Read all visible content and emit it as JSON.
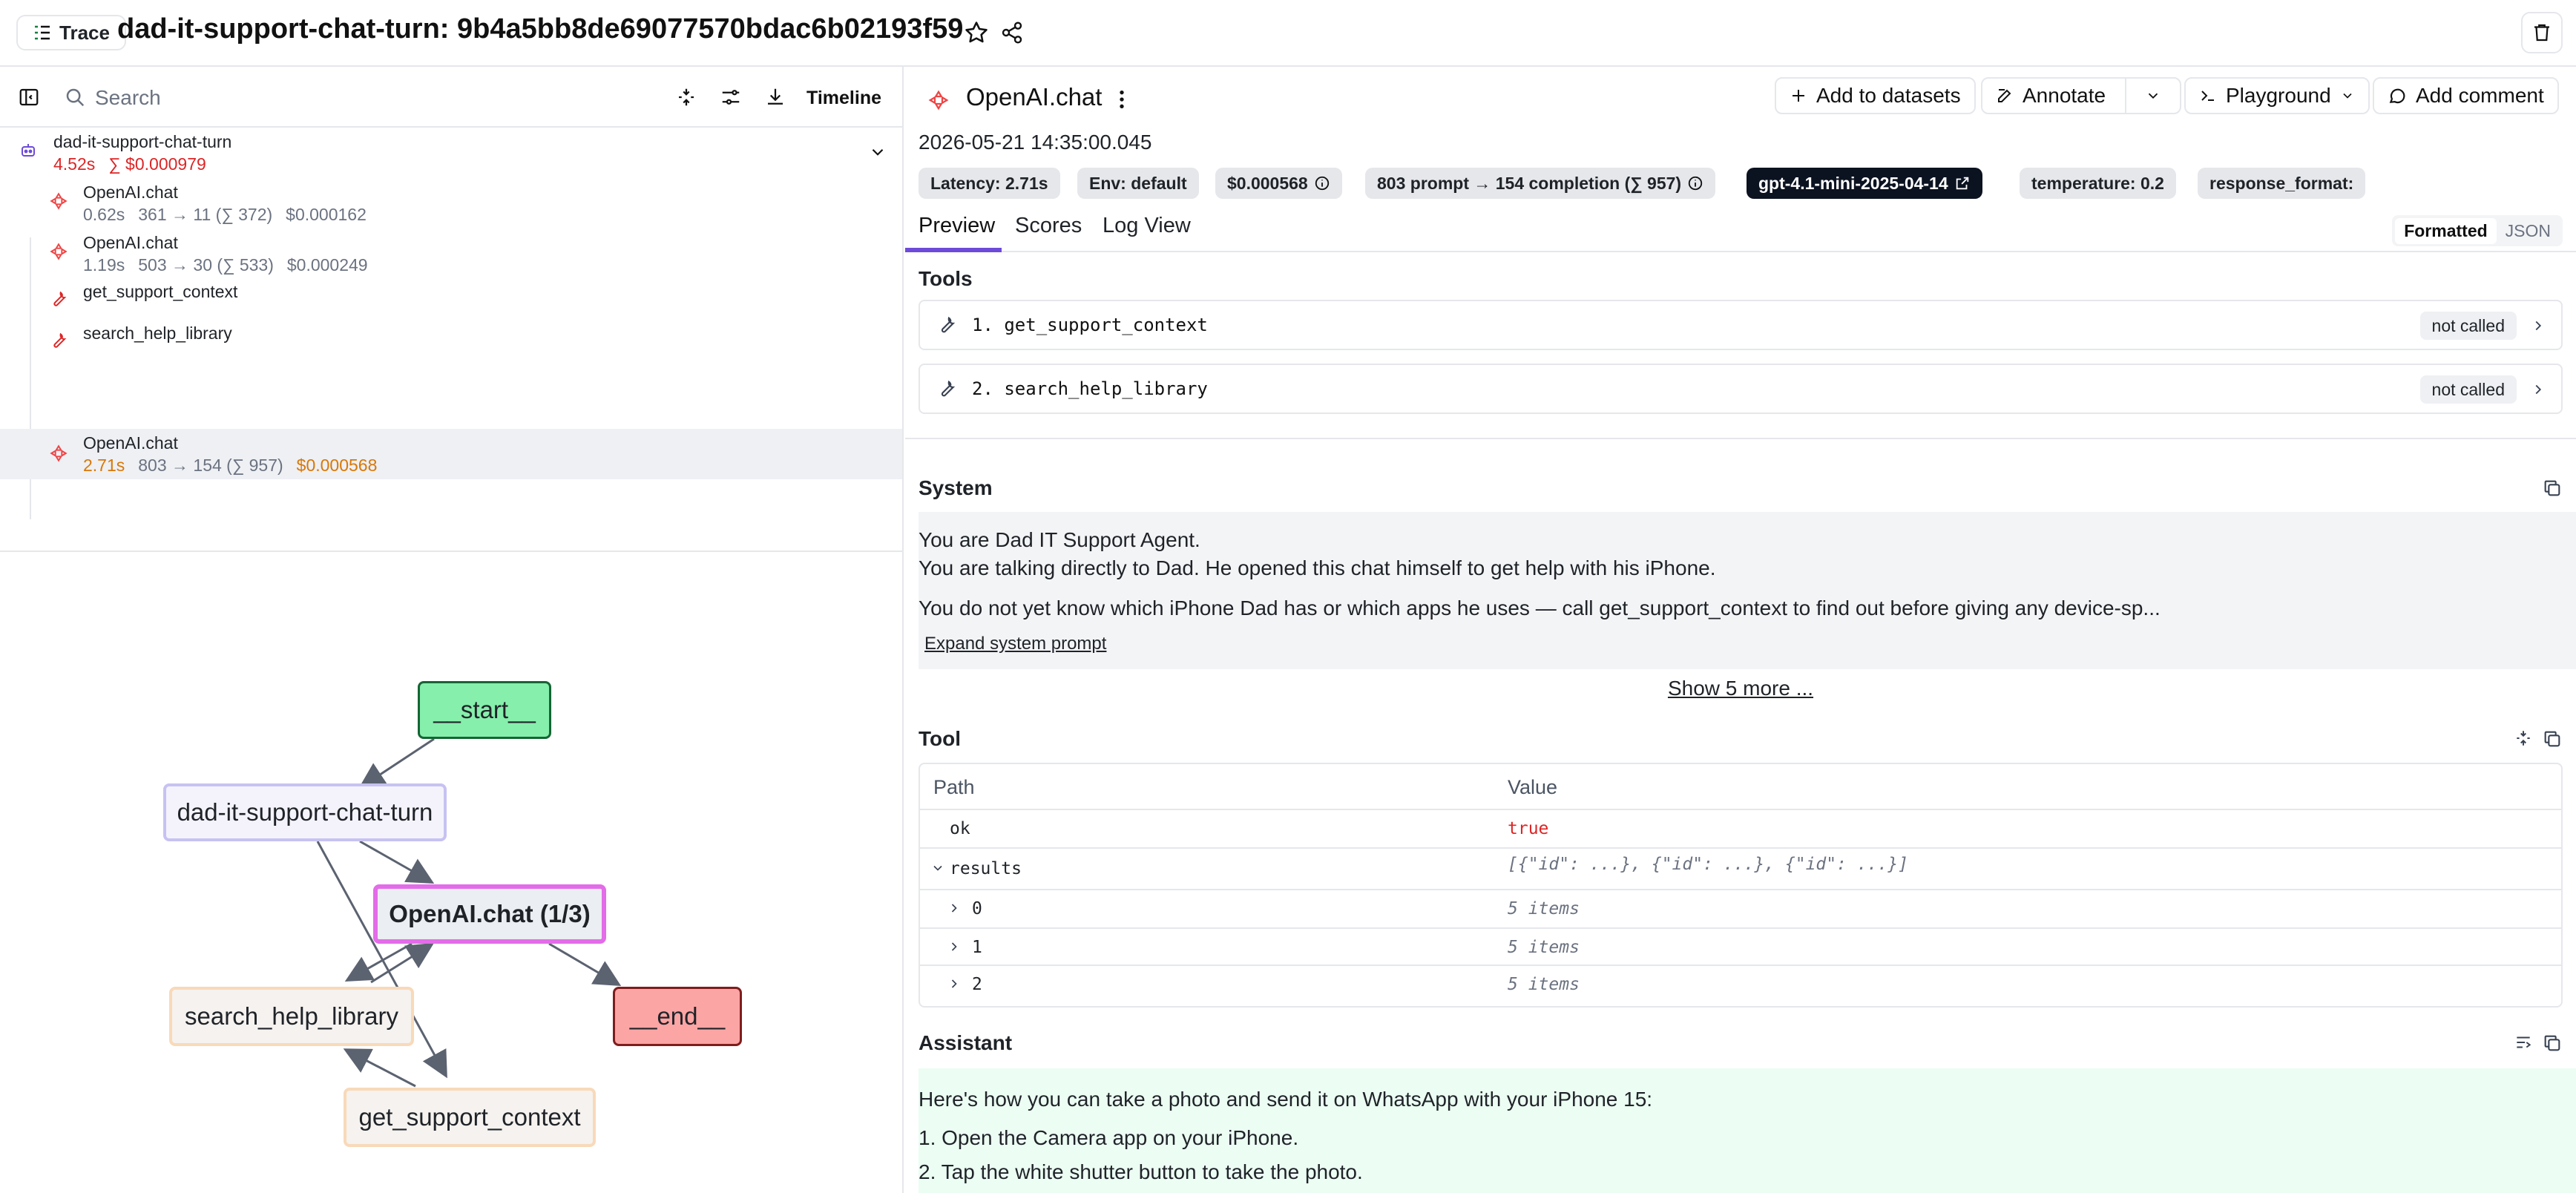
{
  "topbar": {
    "trace_label": "Trace",
    "title": "dad-it-support-chat-turn: 9b4a5bb8de69077570bdac6b02193f59"
  },
  "left": {
    "search_placeholder": "Search",
    "timeline_label": "Timeline",
    "tree": [
      {
        "name": "dad-it-support-chat-turn",
        "latency": "4.52s",
        "cost": "∑ $0.000979",
        "tokens": ""
      },
      {
        "name": "OpenAI.chat",
        "latency": "0.62s",
        "tokens": "361 → 11 (∑ 372)",
        "cost": "$0.000162"
      },
      {
        "name": "OpenAI.chat",
        "latency": "1.19s",
        "tokens": "503 → 30 (∑ 533)",
        "cost": "$0.000249"
      },
      {
        "name": "get_support_context",
        "latency": "",
        "tokens": "",
        "cost": ""
      },
      {
        "name": "search_help_library",
        "latency": "",
        "tokens": "",
        "cost": ""
      },
      {
        "name": "OpenAI.chat",
        "latency": "2.71s",
        "tokens": "803 → 154 (∑ 957)",
        "cost": "$0.000568"
      }
    ],
    "graph": {
      "start": "__start__",
      "turn": "dad-it-support-chat-turn",
      "openai": "OpenAI.chat (1/3)",
      "search": "search_help_library",
      "end": "__end__",
      "context": "get_support_context"
    }
  },
  "right": {
    "span_title": "OpenAI.chat",
    "buttons": {
      "add_to_datasets": "Add to datasets",
      "annotate": "Annotate",
      "playground": "Playground",
      "add_comment": "Add comment"
    },
    "timestamp": "2026-05-21 14:35:00.045",
    "chips": {
      "latency": "Latency: 2.71s",
      "env": "Env: default",
      "cost": "$0.000568",
      "tokens": "803 prompt → 154 completion (∑ 957)",
      "model": "gpt-4.1-mini-2025-04-14",
      "temperature": "temperature: 0.2",
      "response_format": "response_format:"
    },
    "tabs": {
      "preview": "Preview",
      "scores": "Scores",
      "log_view": "Log View"
    },
    "format": {
      "formatted": "Formatted",
      "json": "JSON"
    },
    "tools": {
      "title": "Tools",
      "items": [
        {
          "label": "1. get_support_context",
          "status": "not called"
        },
        {
          "label": "2. search_help_library",
          "status": "not called"
        }
      ]
    },
    "system": {
      "title": "System",
      "line1": "You are Dad IT Support Agent.",
      "line2": "You are talking directly to Dad. He opened this chat himself to get help with his iPhone.",
      "line3": "You do not yet know which iPhone Dad has or which apps he uses — call get_support_context to find out before giving any device-sp...",
      "expand": "Expand system prompt"
    },
    "show_more": "Show 5 more ...",
    "tool": {
      "title": "Tool",
      "col_path": "Path",
      "col_value": "Value",
      "rows": [
        {
          "path": "ok",
          "value": "true"
        },
        {
          "path": "results",
          "value": "[{\"id\": ...}, {\"id\": ...}, {\"id\": ...}]"
        },
        {
          "path": "0",
          "value": "5 items"
        },
        {
          "path": "1",
          "value": "5 items"
        },
        {
          "path": "2",
          "value": "5 items"
        }
      ]
    },
    "assistant": {
      "title": "Assistant",
      "line1": "Here's how you can take a photo and send it on WhatsApp with your iPhone 15:",
      "line2": "1. Open the Camera app on your iPhone.",
      "line3": "2. Tap the white shutter button to take the photo."
    }
  }
}
